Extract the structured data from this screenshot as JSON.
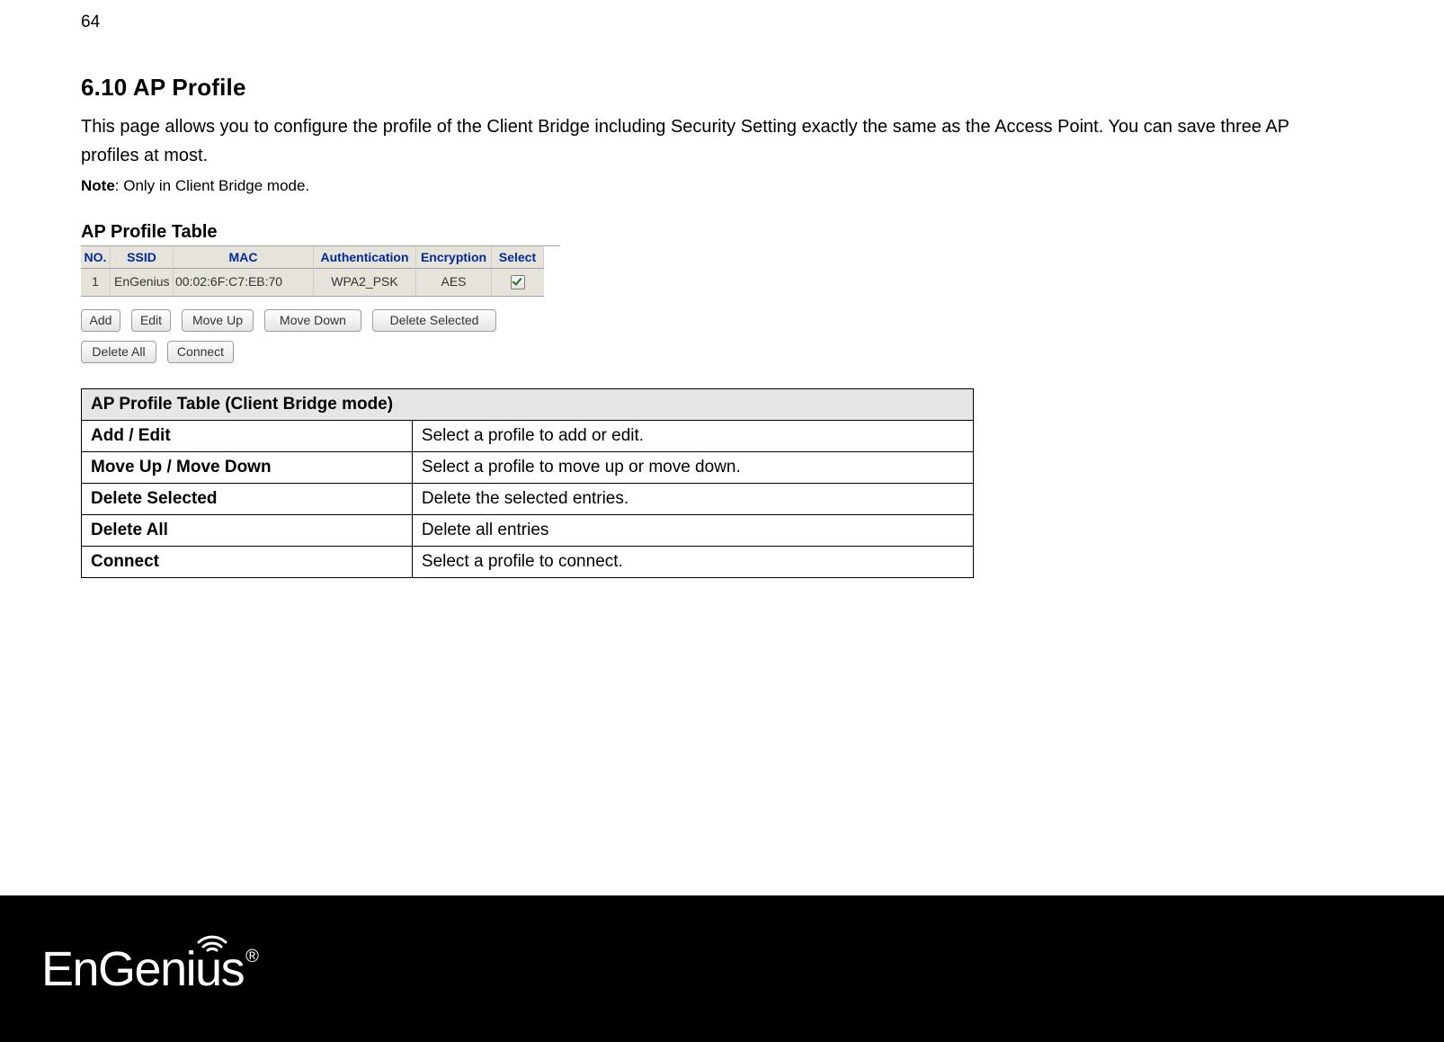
{
  "page_number": "64",
  "heading": "6.10   AP Profile",
  "intro": "This page allows you to configure the profile of the Client Bridge including Security Setting exactly the same as the Access Point. You can save three AP profiles at most.",
  "note_label": "Note",
  "note_text": ": Only in Client Bridge mode.",
  "ap_table": {
    "title": "AP Profile Table",
    "headers": {
      "no": "NO.",
      "ssid": "SSID",
      "mac": "MAC",
      "auth": "Authentication",
      "enc": "Encryption",
      "select": "Select"
    },
    "row": {
      "no": "1",
      "ssid": "EnGenius",
      "mac": "00:02:6F:C7:EB:70",
      "auth": "WPA2_PSK",
      "enc": "AES"
    },
    "buttons": {
      "add": "Add",
      "edit": "Edit",
      "moveup": "Move Up",
      "movedown": "Move Down",
      "delsel": "Delete Selected",
      "delall": "Delete All",
      "connect": "Connect"
    }
  },
  "desc": {
    "title": "AP Profile Table (Client Bridge mode)",
    "rows": [
      {
        "k": "Add / Edit",
        "v": "Select a profile to add or edit."
      },
      {
        "k": "Move Up / Move Down",
        "v": "Select a profile to move up or move down."
      },
      {
        "k": "Delete Selected",
        "v": "Delete the selected entries."
      },
      {
        "k": "Delete All",
        "v": "Delete all entries"
      },
      {
        "k": "Connect",
        "v": "Select a profile to connect."
      }
    ]
  },
  "logo": {
    "text_a": "EnGen",
    "text_b": "ius",
    "reg": "®"
  }
}
